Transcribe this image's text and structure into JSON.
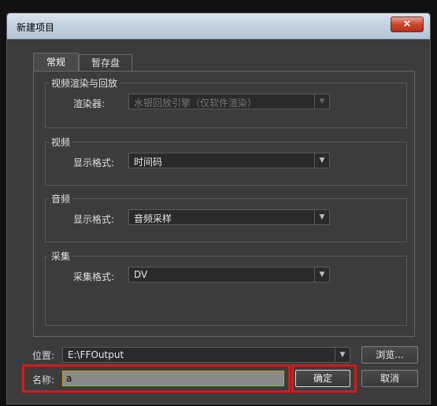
{
  "window": {
    "title": "新建项目",
    "close_label": "×"
  },
  "tabs": [
    {
      "label": "常规",
      "active": true
    },
    {
      "label": "暂存盘",
      "active": false
    }
  ],
  "groups": {
    "video_render": {
      "title": "视频渲染与回放",
      "label": "渲染器:",
      "value": "水银回放引擎（仅软件渲染）",
      "enabled": false
    },
    "video": {
      "title": "视频",
      "label": "显示格式:",
      "value": "时间码"
    },
    "audio": {
      "title": "音频",
      "label": "显示格式:",
      "value": "音频采样"
    },
    "capture": {
      "title": "采集",
      "label": "采集格式:",
      "value": "DV"
    }
  },
  "location": {
    "label": "位置:",
    "value": "E:\\FFOutput",
    "browse_label": "浏览..."
  },
  "name": {
    "label": "名称:",
    "value": "a"
  },
  "buttons": {
    "ok": "确定",
    "cancel": "取消"
  },
  "icons": {
    "dropdown_arrow": "▼"
  },
  "colors": {
    "highlight": "#d41a1a",
    "dialog_bg": "#3c3c3c"
  }
}
